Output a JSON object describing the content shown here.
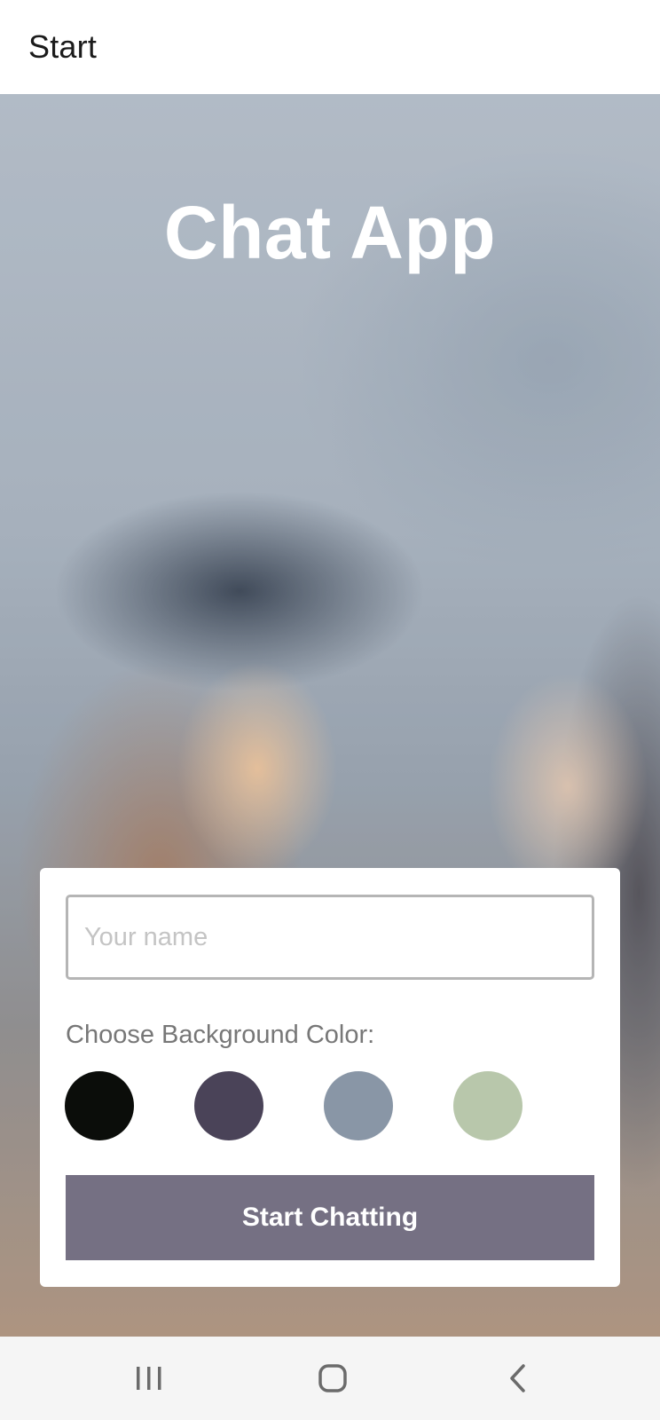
{
  "header": {
    "title": "Start"
  },
  "hero": {
    "title": "Chat App"
  },
  "form": {
    "name_placeholder": "Your name",
    "name_value": "",
    "color_label": "Choose Background Color:",
    "colors": [
      "#0b0d0a",
      "#4a4358",
      "#8996a6",
      "#b8c7ab"
    ],
    "button_label": "Start Chatting",
    "button_color": "#757083"
  },
  "navbar": {
    "icons": [
      "recent-apps-icon",
      "home-icon",
      "back-icon"
    ]
  }
}
